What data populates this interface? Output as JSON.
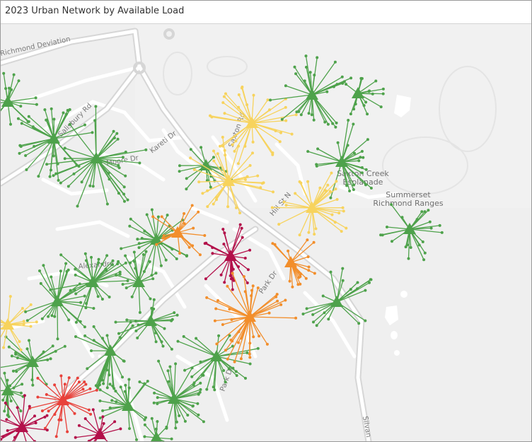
{
  "title": "2023 Urban Network by Available Load",
  "colors": {
    "green": "#4ea24b",
    "yellow": "#f7d35d",
    "orange": "#f28e2b",
    "red": "#e8413a",
    "crimson": "#b3104a",
    "road": "#ffffff",
    "road_major": "#d2d2d2",
    "land": "#efefef",
    "water": "#ffffff"
  },
  "places": [
    {
      "id": "saxton-creek",
      "lines": [
        "Saxton Creek",
        "Esplanade"
      ]
    },
    {
      "id": "summerset",
      "lines": [
        "Summerset",
        "Richmond Ranges"
      ]
    }
  ],
  "roads": [
    {
      "id": "richmond-deviation",
      "label": "Richmond Deviation"
    },
    {
      "id": "kareti-dr",
      "label": "Kareti Dr"
    },
    {
      "id": "salisbury-rd",
      "label": "Salisbury Rd"
    },
    {
      "id": "moore-dr",
      "label": "Moore Dr"
    },
    {
      "id": "saxton-rd",
      "label": "Saxton Rd"
    },
    {
      "id": "hill-st-n",
      "label": "Hill St N"
    },
    {
      "id": "park-dr",
      "label": "Park Dr"
    },
    {
      "id": "park-dr-2",
      "label": "Park Dr"
    },
    {
      "id": "alexandra",
      "label": "Alexandra"
    },
    {
      "id": "silvan",
      "label": "Silvan"
    }
  ],
  "substations": [
    {
      "id": "s1",
      "load": "green",
      "lon_lat": [
        172.9,
        -41.3
      ]
    },
    {
      "id": "s2",
      "load": "green"
    },
    {
      "id": "s3",
      "load": "green"
    },
    {
      "id": "s4",
      "load": "yellow"
    },
    {
      "id": "s5",
      "load": "green"
    },
    {
      "id": "s6",
      "load": "green"
    },
    {
      "id": "s7",
      "load": "yellow"
    },
    {
      "id": "s8",
      "load": "green"
    },
    {
      "id": "s9",
      "load": "green"
    },
    {
      "id": "s10",
      "load": "orange"
    },
    {
      "id": "s11",
      "load": "crimson"
    },
    {
      "id": "s12",
      "load": "orange"
    },
    {
      "id": "s13",
      "load": "yellow"
    },
    {
      "id": "s14",
      "load": "green"
    },
    {
      "id": "s15",
      "load": "green"
    },
    {
      "id": "s16",
      "load": "orange"
    },
    {
      "id": "s17",
      "load": "green"
    },
    {
      "id": "s18",
      "load": "red"
    },
    {
      "id": "s19",
      "load": "crimson"
    }
  ]
}
